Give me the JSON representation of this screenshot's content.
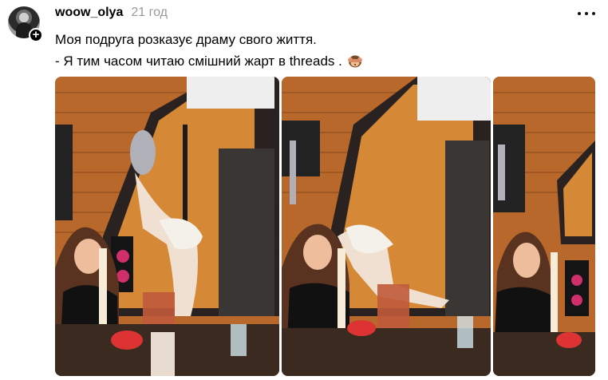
{
  "post": {
    "username": "woow_olya",
    "time": "21 год",
    "caption_line1": "Моя подруга розказує драму свого життя.",
    "caption_line2": "- Я тим часом читаю смішний жарт в threads .",
    "emoji": "see-no-evil-monkey-icon"
  },
  "colors": {
    "wood": "#c8772e",
    "wood_dark": "#8a4a1c",
    "window_glow": "#f39a3b",
    "time_gray": "#999999"
  },
  "media": {
    "frames": [
      "photo-frame-1",
      "photo-frame-2",
      "photo-frame-3"
    ]
  }
}
